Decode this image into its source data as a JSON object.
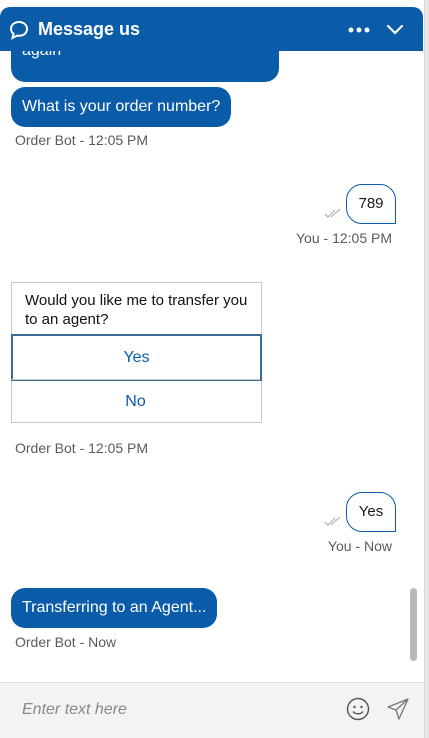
{
  "header": {
    "title": "Message us",
    "icons": {
      "chat": "speech-bubble-icon",
      "menu": "more-icon",
      "collapse": "chevron-down-icon"
    }
  },
  "messages": {
    "bot_partial": "again",
    "bot_question": "What is your order number?",
    "bot_question_meta": "Order Bot - 12:05 PM",
    "user_order": "789",
    "user_order_meta": "You - 12:05 PM",
    "transfer_prompt": {
      "question": "Would you like me to transfer you to an agent?",
      "options": [
        "Yes",
        "No"
      ],
      "meta": "Order Bot - 12:05 PM"
    },
    "user_reply": "Yes",
    "user_reply_meta": "You - Now",
    "bot_transfer": "Transferring to an Agent...",
    "bot_transfer_meta": "Order Bot - Now"
  },
  "composer": {
    "placeholder": "Enter text here",
    "icons": {
      "emoji": "smiley-icon",
      "send": "send-icon"
    }
  },
  "colors": {
    "brand": "#0a5ca8",
    "meta_text": "#5a5a5a",
    "background": "#ffffff"
  }
}
